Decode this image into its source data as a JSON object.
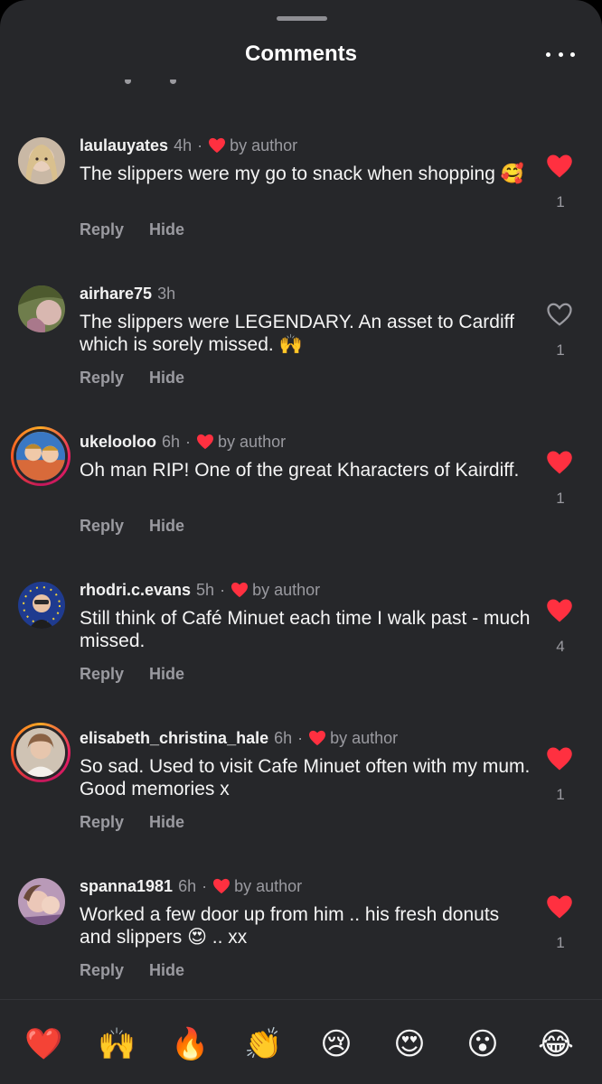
{
  "header": {
    "title": "Comments"
  },
  "comments": [
    {
      "username": "laulauyates",
      "time": "4h",
      "liked_by_author": true,
      "by_author_label": "by author",
      "text": "The slippers were my go to snack when shopping 🥰",
      "reply_label": "Reply",
      "hide_label": "Hide",
      "liked": true,
      "like_count": "1"
    },
    {
      "username": "airhare75",
      "time": "3h",
      "liked_by_author": false,
      "by_author_label": "",
      "text": "The slippers were LEGENDARY. An asset to Cardiff which is sorely missed. 🙌",
      "reply_label": "Reply",
      "hide_label": "Hide",
      "liked": false,
      "like_count": "1"
    },
    {
      "username": "ukelooloo",
      "time": "6h",
      "liked_by_author": true,
      "by_author_label": "by author",
      "text": "Oh man RIP! One of the great Kharacters of Kairdiff.",
      "reply_label": "Reply",
      "hide_label": "Hide",
      "liked": true,
      "like_count": "1"
    },
    {
      "username": "rhodri.c.evans",
      "time": "5h",
      "liked_by_author": true,
      "by_author_label": "by author",
      "text": "Still think of Café Minuet each time I walk past - much missed.",
      "reply_label": "Reply",
      "hide_label": "Hide",
      "liked": true,
      "like_count": "4"
    },
    {
      "username": "elisabeth_christina_hale",
      "time": "6h",
      "liked_by_author": true,
      "by_author_label": "by author",
      "text": "So sad. Used  to visit Cafe Minuet often with my mum. Good memories x",
      "reply_label": "Reply",
      "hide_label": "Hide",
      "liked": true,
      "like_count": "1"
    },
    {
      "username": "spanna1981",
      "time": "6h",
      "liked_by_author": true,
      "by_author_label": "by author",
      "text": "Worked a few door up from him .. his fresh donuts and slippers 😍  .. xx",
      "reply_label": "Reply",
      "hide_label": "Hide",
      "liked": true,
      "like_count": "1"
    }
  ],
  "emoji_bar": [
    "❤️",
    "🙌",
    "🔥",
    "👏",
    "😢",
    "😍",
    "😮",
    "😂"
  ],
  "colors": {
    "background": "#26272a",
    "like_red": "#ff3040",
    "muted_text": "#9a9aa0"
  }
}
